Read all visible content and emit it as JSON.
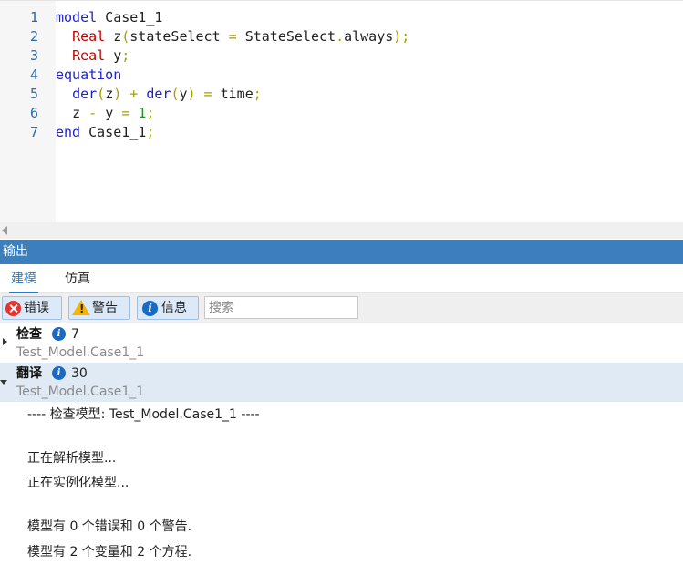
{
  "editor": {
    "line_numbers": [
      "1",
      "2",
      "3",
      "4",
      "5",
      "6",
      "7"
    ],
    "line1": {
      "kw": "model",
      "name": " Case1_1"
    },
    "line2": {
      "type": "Real",
      "t1": " z",
      "op1": "(",
      "t2": "stateSelect",
      "op2": " = ",
      "t3": "StateSelect",
      "op3": ".",
      "t4": "always",
      "op4": ");"
    },
    "line3": {
      "type": "Real",
      "t1": " y",
      "op1": ";"
    },
    "line4": {
      "kw": "equation"
    },
    "line5": {
      "fn1": "der",
      "op1": "(",
      "t1": "z",
      "op2": ") + ",
      "fn2": "der",
      "op3": "(",
      "t2": "y",
      "op4": ") = ",
      "t3": "time",
      "op5": ";"
    },
    "line6": {
      "t1": "z",
      "op1": " - ",
      "t2": "y",
      "op2": " = ",
      "num": "1",
      "op3": ";"
    },
    "line7": {
      "kw": "end",
      "name": " Case1_1",
      "op1": ";"
    }
  },
  "output_panel": {
    "title": "输出",
    "tabs": [
      {
        "label": "建模",
        "active": true
      },
      {
        "label": "仿真",
        "active": false
      }
    ],
    "toolbar": {
      "errors_label": "错误",
      "warnings_label": "警告",
      "info_label": "信息",
      "search_placeholder": "搜索"
    },
    "groups": [
      {
        "title": "检查",
        "count": "7",
        "subtitle": "Test_Model.Case1_1",
        "expanded": false
      },
      {
        "title": "翻译",
        "count": "30",
        "subtitle": "Test_Model.Case1_1",
        "expanded": true
      }
    ],
    "messages": [
      "---- 检查模型: Test_Model.Case1_1 ----",
      "正在解析模型...",
      "正在实例化模型...",
      "模型有 0 个错误和 0 个警告.",
      "模型有 2 个变量和 2 个方程."
    ]
  },
  "colors": {
    "keyword": "#1f22c8",
    "type": "#c00000",
    "operator": "#a4a000",
    "number": "#1f8f1f",
    "header": "#3c7fbe",
    "accent": "#2a7bc6"
  }
}
